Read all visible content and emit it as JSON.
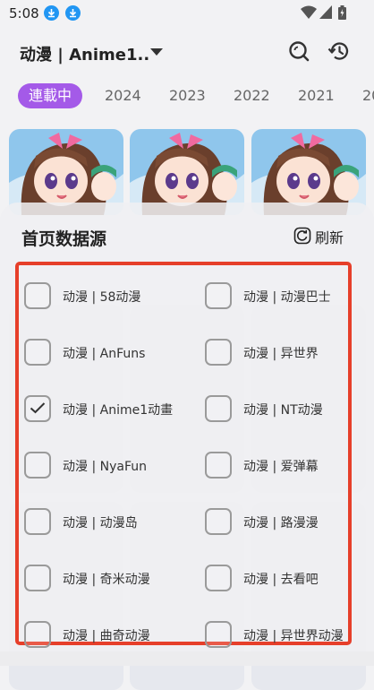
{
  "status_bar": {
    "time": "5:08",
    "icons": [
      "download-icon",
      "download-icon",
      "wifi-icon",
      "cellular-icon",
      "battery-icon"
    ],
    "accent": "#2196f3"
  },
  "header": {
    "source_title": "动漫 | Anime1..",
    "icons": [
      "chevron-down-icon",
      "search-icon",
      "history-icon"
    ]
  },
  "tabs": [
    {
      "label": "連載中",
      "active": true
    },
    {
      "label": "2024"
    },
    {
      "label": "2023"
    },
    {
      "label": "2022"
    },
    {
      "label": "2021"
    },
    {
      "label": "20"
    }
  ],
  "theme": {
    "accent": "#a45ae8",
    "frame": "#e63f2a"
  },
  "sheet": {
    "title": "首页数据源",
    "refresh_label": "刷新",
    "sources": [
      {
        "label": "动漫 | 58动漫",
        "checked": false
      },
      {
        "label": "动漫 | 动漫巴士",
        "checked": false
      },
      {
        "label": "动漫 | AnFuns",
        "checked": false
      },
      {
        "label": "动漫 | 异世界",
        "checked": false
      },
      {
        "label": "动漫 | Anime1动畫",
        "checked": true
      },
      {
        "label": "动漫 | NT动漫",
        "checked": false
      },
      {
        "label": "动漫 | NyaFun",
        "checked": false
      },
      {
        "label": "动漫 | 爱弹幕",
        "checked": false
      },
      {
        "label": "动漫 | 动漫岛",
        "checked": false
      },
      {
        "label": "动漫 | 路漫漫",
        "checked": false
      },
      {
        "label": "动漫 | 奇米动漫",
        "checked": false
      },
      {
        "label": "动漫 | 去看吧",
        "checked": false
      },
      {
        "label": "动漫 | 曲奇动漫",
        "checked": false
      },
      {
        "label": "动漫 | 异世界动漫",
        "checked": false
      }
    ]
  }
}
